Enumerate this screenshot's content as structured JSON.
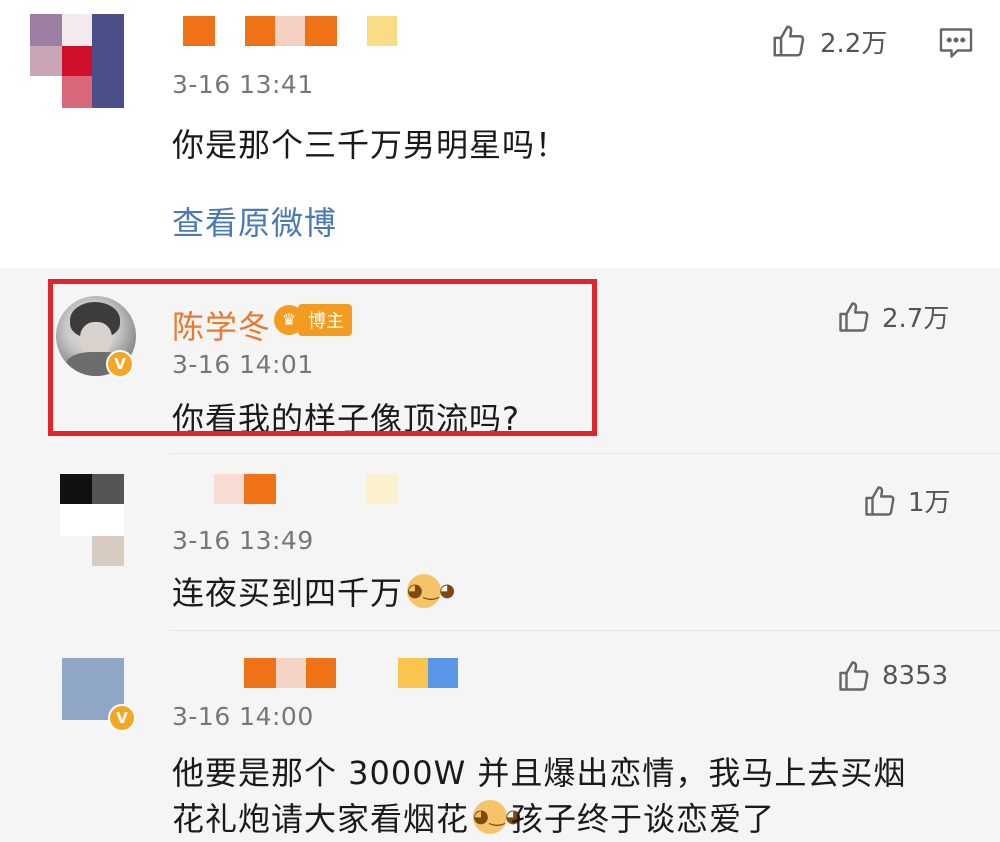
{
  "comments": [
    {
      "time": "3-16 13:41",
      "text": "你是那个三千万男明星吗！",
      "likes": "2.2万",
      "link": "查看原微博"
    },
    {
      "name": "陈学冬",
      "badge": "博主",
      "time": "3-16 14:01",
      "text": "你看我的样子像顶流吗?",
      "likes": "2.7万"
    },
    {
      "time": "3-16 13:49",
      "text": "连夜买到四千万",
      "likes": "1万"
    },
    {
      "time": "3-16 14:00",
      "text_line1": "他要是那个 3000W 并且爆出恋情，我马上去买烟",
      "text_line2a": "花礼炮请大家看烟花",
      "text_line2b": "孩子终于谈恋爱了",
      "likes": "8353"
    }
  ],
  "icons": {
    "like": "thumbs-up-icon",
    "reply": "comment-icon",
    "verified": "verified-v-icon",
    "emoji": "doge-emoji-icon"
  },
  "colors": {
    "highlight": "#e0262a",
    "name": "#e8792f",
    "link": "#4a79b5",
    "badge": "#f39c1f"
  }
}
